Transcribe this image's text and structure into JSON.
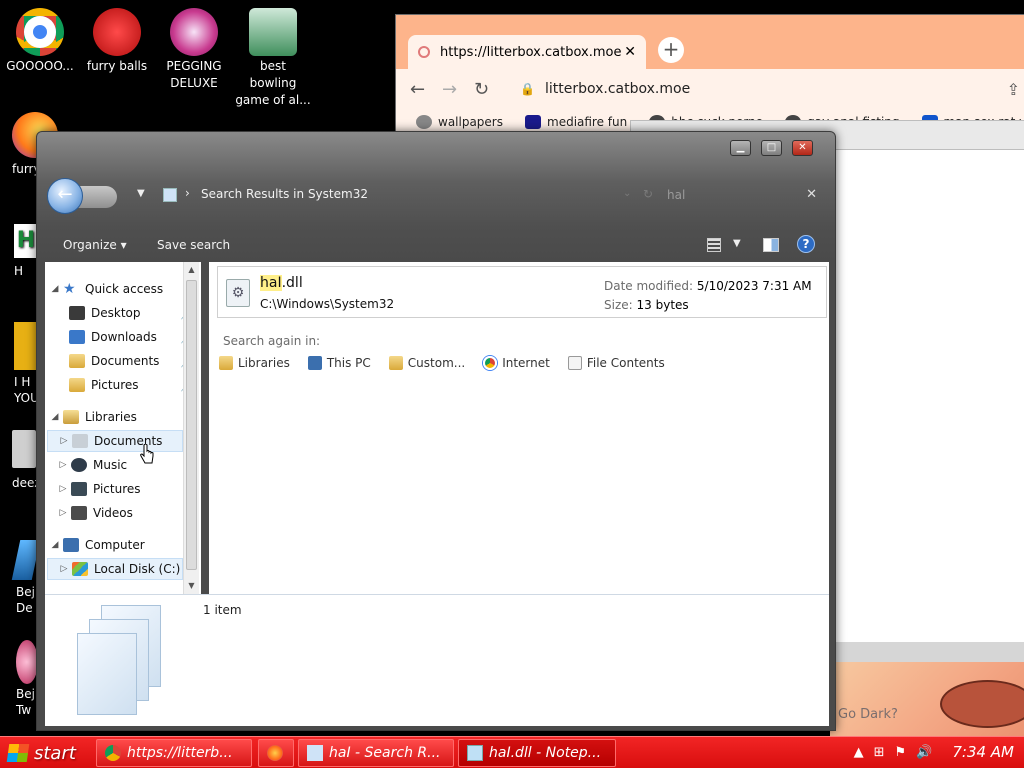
{
  "desktop": {
    "icons": [
      {
        "label": "GOOOOO...",
        "color": "#4285f4"
      },
      {
        "label": "furry balls",
        "color": "#e32020"
      },
      {
        "label": "PEGGING DELUXE",
        "color": "#d0308a"
      },
      {
        "label": "best bowling game of al...",
        "color": "#4aa06a"
      }
    ],
    "partial_labels": [
      "furry",
      "H",
      "I H YOU",
      "deez",
      "Bej De",
      "Bej Tw"
    ]
  },
  "browser": {
    "tab_title": "https://litterbox.catbox.moe",
    "address": "litterbox.catbox.moe",
    "bookmarks": [
      "wallpapers",
      "mediafire fun",
      "bbc cuck porno",
      "gay anal fisting",
      "man sex rat video"
    ],
    "overlay_text": "Go Dark?"
  },
  "explorer": {
    "breadcrumb": "Search Results in System32",
    "search_query": "hal",
    "toolbar": {
      "organize": "Organize",
      "save_search": "Save search"
    },
    "nav": {
      "quick_access": "Quick access",
      "desktop": "Desktop",
      "downloads": "Downloads",
      "documents": "Documents",
      "pictures": "Pictures",
      "libraries": "Libraries",
      "lib_documents": "Documents",
      "lib_music": "Music",
      "lib_pictures": "Pictures",
      "lib_videos": "Videos",
      "computer": "Computer",
      "local_disk": "Local Disk (C:)"
    },
    "result": {
      "name_match": "haI",
      "name_rest": ".dll",
      "path": "C:\\Windows\\System32",
      "date_label": "Date modified:",
      "date_value": "5/10/2023 7:31 AM",
      "size_label": "Size:",
      "size_value": "13 bytes"
    },
    "search_again": {
      "label": "Search again in:",
      "items": [
        "Libraries",
        "This PC",
        "Custom...",
        "Internet",
        "File Contents"
      ]
    },
    "status": "1 item"
  },
  "taskbar": {
    "start": "start",
    "buttons": [
      "https://litterb...",
      "haI - Search R...",
      "haI.dll - Notep..."
    ],
    "clock": "7:34 AM"
  }
}
